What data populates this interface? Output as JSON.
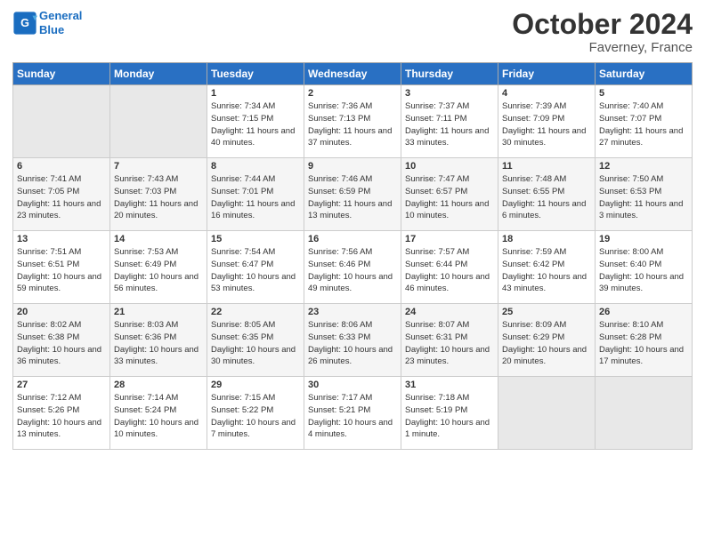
{
  "header": {
    "logo_line1": "General",
    "logo_line2": "Blue",
    "month": "October 2024",
    "location": "Faverney, France"
  },
  "days_of_week": [
    "Sunday",
    "Monday",
    "Tuesday",
    "Wednesday",
    "Thursday",
    "Friday",
    "Saturday"
  ],
  "weeks": [
    [
      {
        "num": "",
        "info": ""
      },
      {
        "num": "",
        "info": ""
      },
      {
        "num": "1",
        "info": "Sunrise: 7:34 AM\nSunset: 7:15 PM\nDaylight: 11 hours and 40 minutes."
      },
      {
        "num": "2",
        "info": "Sunrise: 7:36 AM\nSunset: 7:13 PM\nDaylight: 11 hours and 37 minutes."
      },
      {
        "num": "3",
        "info": "Sunrise: 7:37 AM\nSunset: 7:11 PM\nDaylight: 11 hours and 33 minutes."
      },
      {
        "num": "4",
        "info": "Sunrise: 7:39 AM\nSunset: 7:09 PM\nDaylight: 11 hours and 30 minutes."
      },
      {
        "num": "5",
        "info": "Sunrise: 7:40 AM\nSunset: 7:07 PM\nDaylight: 11 hours and 27 minutes."
      }
    ],
    [
      {
        "num": "6",
        "info": "Sunrise: 7:41 AM\nSunset: 7:05 PM\nDaylight: 11 hours and 23 minutes."
      },
      {
        "num": "7",
        "info": "Sunrise: 7:43 AM\nSunset: 7:03 PM\nDaylight: 11 hours and 20 minutes."
      },
      {
        "num": "8",
        "info": "Sunrise: 7:44 AM\nSunset: 7:01 PM\nDaylight: 11 hours and 16 minutes."
      },
      {
        "num": "9",
        "info": "Sunrise: 7:46 AM\nSunset: 6:59 PM\nDaylight: 11 hours and 13 minutes."
      },
      {
        "num": "10",
        "info": "Sunrise: 7:47 AM\nSunset: 6:57 PM\nDaylight: 11 hours and 10 minutes."
      },
      {
        "num": "11",
        "info": "Sunrise: 7:48 AM\nSunset: 6:55 PM\nDaylight: 11 hours and 6 minutes."
      },
      {
        "num": "12",
        "info": "Sunrise: 7:50 AM\nSunset: 6:53 PM\nDaylight: 11 hours and 3 minutes."
      }
    ],
    [
      {
        "num": "13",
        "info": "Sunrise: 7:51 AM\nSunset: 6:51 PM\nDaylight: 10 hours and 59 minutes."
      },
      {
        "num": "14",
        "info": "Sunrise: 7:53 AM\nSunset: 6:49 PM\nDaylight: 10 hours and 56 minutes."
      },
      {
        "num": "15",
        "info": "Sunrise: 7:54 AM\nSunset: 6:47 PM\nDaylight: 10 hours and 53 minutes."
      },
      {
        "num": "16",
        "info": "Sunrise: 7:56 AM\nSunset: 6:46 PM\nDaylight: 10 hours and 49 minutes."
      },
      {
        "num": "17",
        "info": "Sunrise: 7:57 AM\nSunset: 6:44 PM\nDaylight: 10 hours and 46 minutes."
      },
      {
        "num": "18",
        "info": "Sunrise: 7:59 AM\nSunset: 6:42 PM\nDaylight: 10 hours and 43 minutes."
      },
      {
        "num": "19",
        "info": "Sunrise: 8:00 AM\nSunset: 6:40 PM\nDaylight: 10 hours and 39 minutes."
      }
    ],
    [
      {
        "num": "20",
        "info": "Sunrise: 8:02 AM\nSunset: 6:38 PM\nDaylight: 10 hours and 36 minutes."
      },
      {
        "num": "21",
        "info": "Sunrise: 8:03 AM\nSunset: 6:36 PM\nDaylight: 10 hours and 33 minutes."
      },
      {
        "num": "22",
        "info": "Sunrise: 8:05 AM\nSunset: 6:35 PM\nDaylight: 10 hours and 30 minutes."
      },
      {
        "num": "23",
        "info": "Sunrise: 8:06 AM\nSunset: 6:33 PM\nDaylight: 10 hours and 26 minutes."
      },
      {
        "num": "24",
        "info": "Sunrise: 8:07 AM\nSunset: 6:31 PM\nDaylight: 10 hours and 23 minutes."
      },
      {
        "num": "25",
        "info": "Sunrise: 8:09 AM\nSunset: 6:29 PM\nDaylight: 10 hours and 20 minutes."
      },
      {
        "num": "26",
        "info": "Sunrise: 8:10 AM\nSunset: 6:28 PM\nDaylight: 10 hours and 17 minutes."
      }
    ],
    [
      {
        "num": "27",
        "info": "Sunrise: 7:12 AM\nSunset: 5:26 PM\nDaylight: 10 hours and 13 minutes."
      },
      {
        "num": "28",
        "info": "Sunrise: 7:14 AM\nSunset: 5:24 PM\nDaylight: 10 hours and 10 minutes."
      },
      {
        "num": "29",
        "info": "Sunrise: 7:15 AM\nSunset: 5:22 PM\nDaylight: 10 hours and 7 minutes."
      },
      {
        "num": "30",
        "info": "Sunrise: 7:17 AM\nSunset: 5:21 PM\nDaylight: 10 hours and 4 minutes."
      },
      {
        "num": "31",
        "info": "Sunrise: 7:18 AM\nSunset: 5:19 PM\nDaylight: 10 hours and 1 minute."
      },
      {
        "num": "",
        "info": ""
      },
      {
        "num": "",
        "info": ""
      }
    ]
  ]
}
